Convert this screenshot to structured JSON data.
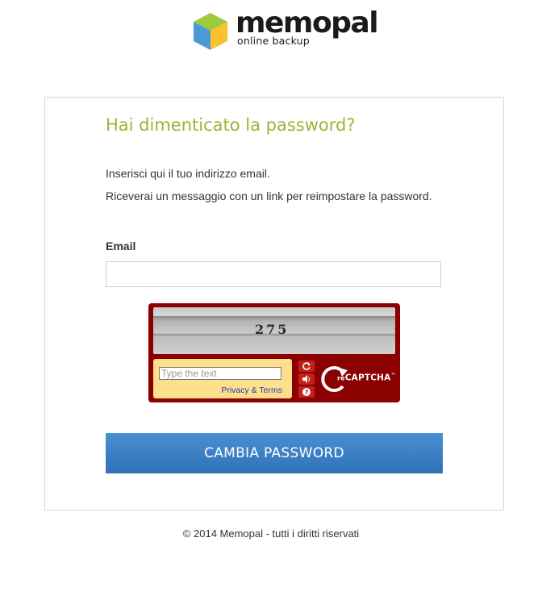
{
  "brand": {
    "name": "memopal",
    "tagline": "online backup",
    "logo_icon": "cube-icon",
    "colors": {
      "green": "#9ccb3b",
      "blue": "#4a9ad6",
      "yellow": "#f9c22e"
    }
  },
  "form": {
    "title": "Hai dimenticato la password?",
    "intro_line1": "Inserisci qui il tuo indirizzo email.",
    "intro_line2": "Riceverai un messaggio con un link per reimpostare la password.",
    "email_label": "Email",
    "email_value": "",
    "submit_label": "CAMBIA PASSWORD",
    "title_color": "#9cb533",
    "button_color": "#3a7fc4"
  },
  "captcha": {
    "challenge_text": "275",
    "input_placeholder": "Type the text",
    "privacy_link": "Privacy & Terms",
    "brand_prefix": "re",
    "brand": "CAPTCHA",
    "trademark": "™",
    "icons": [
      "refresh-icon",
      "audio-icon",
      "help-icon"
    ],
    "background_color": "#8b0000"
  },
  "footer": {
    "text": "© 2014 Memopal - tutti i diritti riservati"
  }
}
